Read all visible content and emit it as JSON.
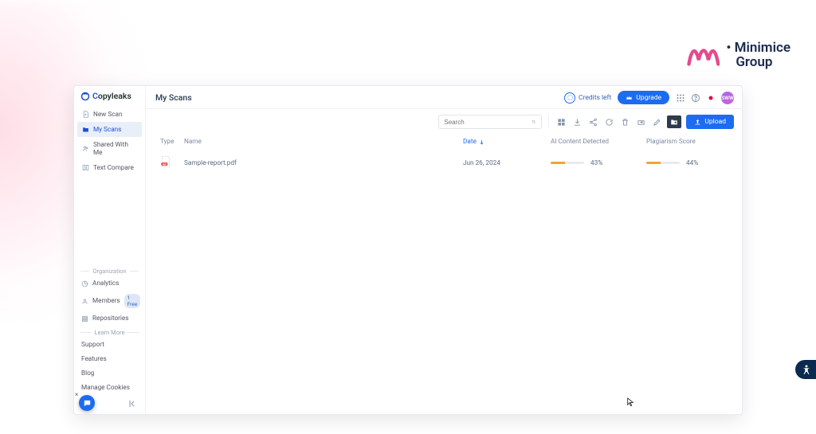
{
  "watermark": {
    "line1": "Minimice",
    "line2": "Group"
  },
  "brand": {
    "name": "opyleaks",
    "prefix": "C"
  },
  "sidebar": {
    "nav": [
      {
        "label": "New Scan"
      },
      {
        "label": "My Scans"
      },
      {
        "label": "Shared With Me"
      },
      {
        "label": "Text Compare"
      }
    ],
    "org_label": "Organization",
    "org": [
      {
        "label": "Analytics"
      },
      {
        "label": "Members",
        "pill": "1 Free"
      },
      {
        "label": "Repositories"
      }
    ],
    "learn_label": "Learn More",
    "learn": [
      {
        "label": "Support"
      },
      {
        "label": "Features"
      },
      {
        "label": "Blog"
      },
      {
        "label": "Manage Cookies"
      }
    ]
  },
  "header": {
    "title": "My Scans",
    "credits_label": "Credits left",
    "upgrade": "Upgrade",
    "avatar_initials": "SWW"
  },
  "toolbar": {
    "search_placeholder": "Search",
    "upload": "Upload"
  },
  "table": {
    "columns": {
      "type": "Type",
      "name": "Name",
      "date": "Date",
      "ai": "AI Content Detected",
      "plag": "Plagiarism Score"
    },
    "rows": [
      {
        "name": "Sample-report.pdf",
        "date": "Jun 26, 2024",
        "ai_pct": "43%",
        "ai_w": "43%",
        "plag_pct": "44%",
        "plag_w": "44%"
      }
    ]
  }
}
